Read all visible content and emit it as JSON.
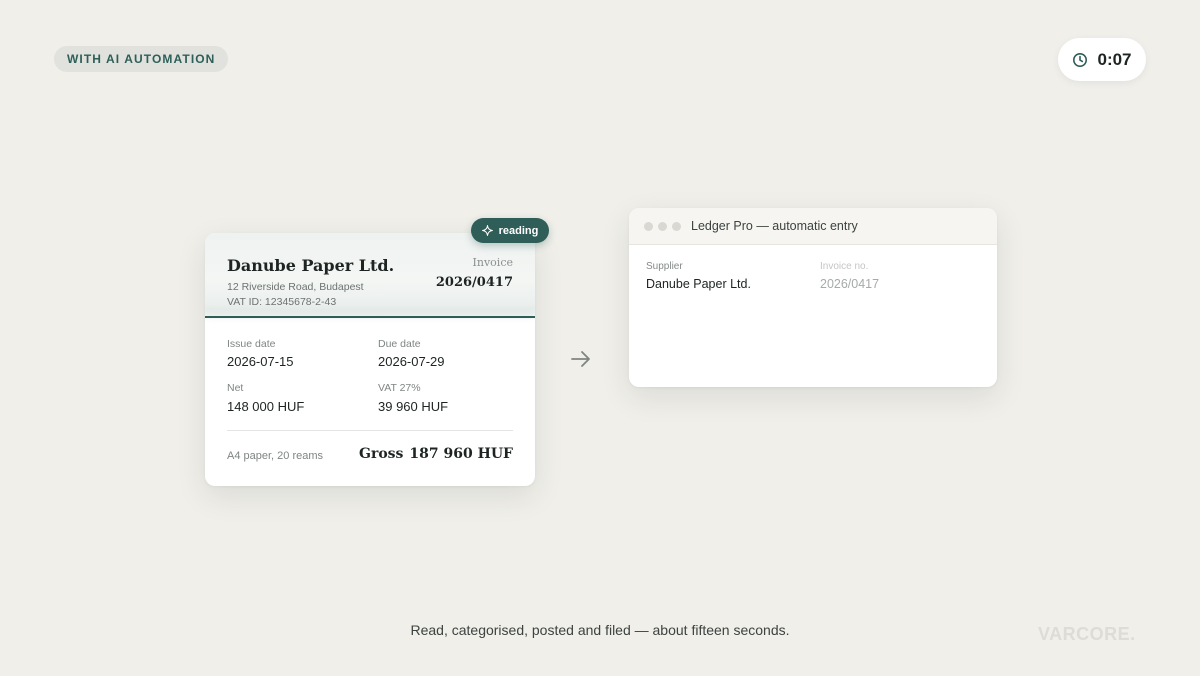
{
  "mode_badge": "WITH AI AUTOMATION",
  "timer": {
    "value": "0:07",
    "icon": "clock-icon"
  },
  "invoice": {
    "supplier_name": "Danube Paper Ltd.",
    "supplier_address": "12 Riverside Road, Budapest",
    "supplier_vat": "VAT ID: 12345678-2-43",
    "doc_label": "Invoice",
    "doc_number": "2026/0417",
    "issue_date_label": "Issue date",
    "issue_date": "2026-07-15",
    "due_date_label": "Due date",
    "due_date": "2026-07-29",
    "net_label": "Net",
    "net": "148 000 HUF",
    "vat_label": "VAT 27%",
    "vat": "39 960 HUF",
    "line_item": "A4 paper, 20 reams",
    "gross_label": "Gross",
    "gross": "187 960 HUF"
  },
  "reading_status": {
    "label": "reading",
    "icon": "sparkle-icon"
  },
  "flow_icon": "arrow-right-icon",
  "ledger": {
    "title": "Ledger Pro — automatic entry",
    "supplier_label": "Supplier",
    "supplier_value": "Danube Paper Ltd.",
    "invoice_no_label": "Invoice no.",
    "invoice_no_value": "2026/0417"
  },
  "caption": "Read, categorised, posted and filed — about fifteen seconds.",
  "brand": "VARCORE.",
  "colors": {
    "background": "#f0efea",
    "accent": "#2f5d57",
    "card": "#ffffff",
    "badge_bg": "#e1e2dd"
  }
}
